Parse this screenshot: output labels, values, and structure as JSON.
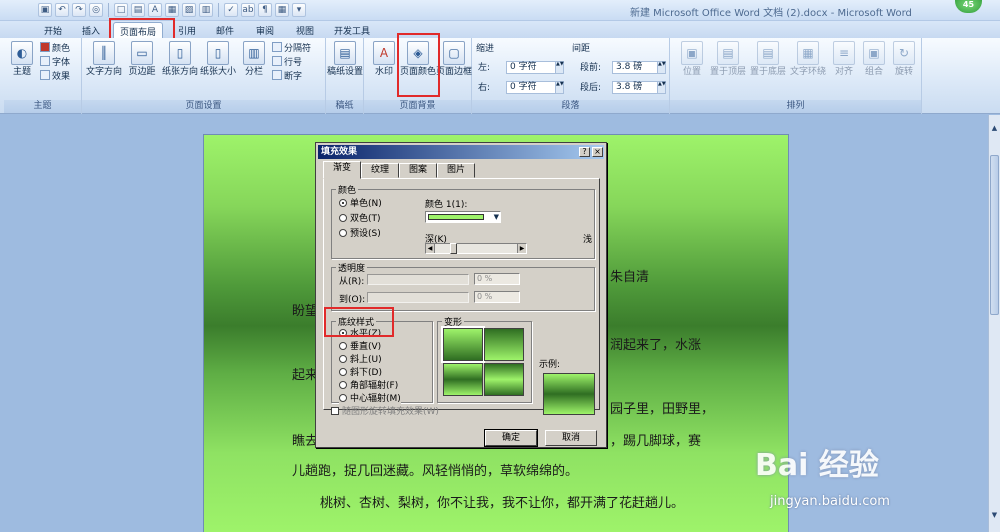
{
  "window": {
    "title": "新建 Microsoft Office Word 文档 (2).docx - Microsoft Word",
    "badge": "45"
  },
  "tabs": [
    {
      "label": "开始"
    },
    {
      "label": "插入"
    },
    {
      "label": "页面布局"
    },
    {
      "label": "引用"
    },
    {
      "label": "邮件"
    },
    {
      "label": "审阅"
    },
    {
      "label": "视图"
    },
    {
      "label": "开发工具"
    }
  ],
  "ribbon": {
    "theme": {
      "big": "主题",
      "colors": "颜色",
      "fonts": "字体",
      "effects": "效果",
      "label": "主题"
    },
    "page_setup": {
      "text_dir": "文字方向",
      "margins": "页边距",
      "orientation": "纸张方向",
      "size": "纸张大小",
      "columns": "分栏",
      "breaks": "分隔符",
      "line_numbers": "行号",
      "hyphen": "断字",
      "label": "页面设置"
    },
    "paper": {
      "draft": "稿纸设置",
      "label": "稿纸"
    },
    "background": {
      "watermark": "水印",
      "page_color": "页面颜色",
      "page_border": "页面边框",
      "label": "页面背景"
    },
    "paragraph": {
      "indent": "缩进",
      "left": "左:",
      "left_val": "0 字符",
      "right": "右:",
      "right_val": "0 字符",
      "spacing": "间距",
      "before": "段前:",
      "before_val": "3.8 磅",
      "after": "段后:",
      "after_val": "3.8 磅",
      "label": "段落"
    },
    "arrange": {
      "position": "位置",
      "front": "置于顶层",
      "back": "置于底层",
      "wrap": "文字环绕",
      "align": "对齐",
      "group": "组合",
      "rotate": "旋转",
      "label": "排列"
    }
  },
  "document": {
    "lines": [
      "朱自清",
      "盼望",
      "润起来了，水涨",
      "起来",
      "园子里，田野里，",
      "瞧去",
      "，踢几脚球，赛",
      "儿趟跑，捉几回迷藏。风轻悄悄的，草软绵绵的。",
      "桃树、杏树、梨树，你不让我，我不让你，都开满了花赶趟儿。"
    ]
  },
  "dialog": {
    "title": "填充效果",
    "help": "?",
    "close": "×",
    "tabs": [
      "渐变",
      "纹理",
      "图案",
      "图片"
    ],
    "colors": {
      "legend": "颜色",
      "options": [
        "单色(N)",
        "双色(T)",
        "预设(S)"
      ],
      "color1": "颜色 1(1):",
      "dark": "深(K)",
      "light": "浅"
    },
    "transparency": {
      "legend": "透明度",
      "from": "从(R):",
      "to": "到(O):",
      "from_val": "0 %",
      "to_val": "0 %"
    },
    "shading": {
      "legend": "底纹样式",
      "options": [
        "水平(Z)",
        "垂直(V)",
        "斜上(U)",
        "斜下(D)",
        "角部辐射(F)",
        "中心辐射(M)"
      ],
      "rotate": "随图形旋转填充效果(W)"
    },
    "variants": {
      "legend": "变形"
    },
    "sample": "示例:",
    "ok": "确定",
    "cancel": "取消",
    "fill_color": "#9ef36a"
  },
  "watermark": {
    "brand": "Bai 经验",
    "url": "jingyan.baidu.com"
  }
}
